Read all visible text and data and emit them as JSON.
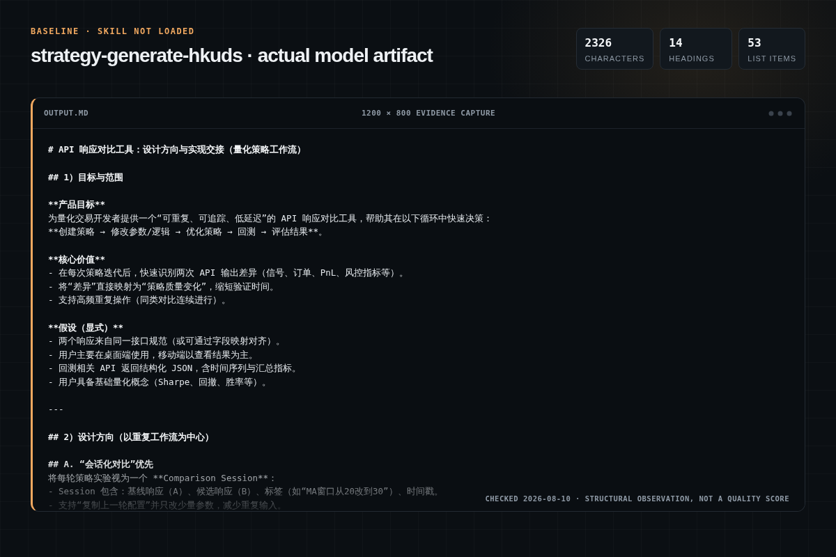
{
  "eyebrow": "BASELINE · SKILL NOT LOADED",
  "title": "strategy-generate-hkuds · actual model artifact",
  "stats": [
    {
      "value": "2326",
      "label": "CHARACTERS"
    },
    {
      "value": "14",
      "label": "HEADINGS"
    },
    {
      "value": "53",
      "label": "LIST ITEMS"
    }
  ],
  "panel": {
    "filename": "OUTPUT.MD",
    "caption": "1200 × 800 EVIDENCE CAPTURE",
    "footer": "CHECKED 2026-08-10 · STRUCTURAL OBSERVATION, NOT A QUALITY SCORE",
    "blocks": [
      [
        {
          "kind": "heading",
          "text": "# API 响应对比工具：设计方向与实现交接（量化策略工作流）"
        }
      ],
      [
        {
          "kind": "heading",
          "text": "## 1）目标与范围"
        }
      ],
      [
        {
          "kind": "strong",
          "text": "**产品目标**"
        },
        {
          "kind": "text",
          "text": "为量化交易开发者提供一个“可重复、可追踪、低延迟”的 API 响应对比工具，帮助其在以下循环中快速决策："
        },
        {
          "kind": "text",
          "text": "**创建策略 → 修改参数/逻辑 → 优化策略 → 回测 → 评估结果**。"
        }
      ],
      [
        {
          "kind": "strong",
          "text": "**核心价值**"
        },
        {
          "kind": "text",
          "text": "- 在每次策略迭代后，快速识别两次 API 输出差异（信号、订单、PnL、风控指标等）。"
        },
        {
          "kind": "text",
          "text": "- 将“差异”直接映射为“策略质量变化”，缩短验证时间。"
        },
        {
          "kind": "text",
          "text": "- 支持高频重复操作（同类对比连续进行）。"
        }
      ],
      [
        {
          "kind": "strong",
          "text": "**假设（显式）**"
        },
        {
          "kind": "text",
          "text": "- 两个响应来自同一接口规范（或可通过字段映射对齐）。"
        },
        {
          "kind": "text",
          "text": "- 用户主要在桌面端使用，移动端以查看结果为主。"
        },
        {
          "kind": "text",
          "text": "- 回测相关 API 返回结构化 JSON，含时间序列与汇总指标。"
        },
        {
          "kind": "text",
          "text": "- 用户具备基础量化概念（Sharpe、回撤、胜率等）。"
        }
      ],
      [
        {
          "kind": "text",
          "text": "---"
        }
      ],
      [
        {
          "kind": "heading",
          "text": "## 2）设计方向（以重复工作流为中心）"
        }
      ],
      [
        {
          "kind": "heading",
          "text": "## A. “会话化对比”优先"
        },
        {
          "kind": "text",
          "text": "将每轮策略实验视为一个 **Comparison Session**："
        },
        {
          "kind": "text",
          "text": "- Session 包含：基线响应（A）、候选响应（B）、标签（如“MA窗口从20改到30”）、时间戳。"
        },
        {
          "kind": "text",
          "text": "- 支持“复制上一轮配置”并只改少量参数，减少重复输入。"
        }
      ]
    ]
  }
}
